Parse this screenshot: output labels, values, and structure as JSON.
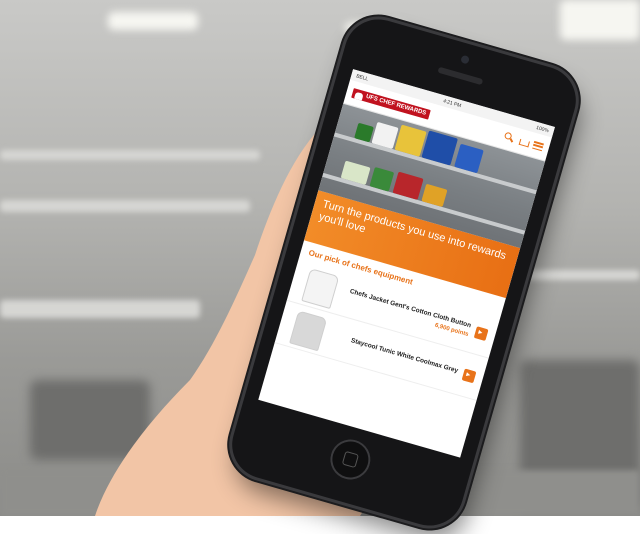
{
  "status_bar": {
    "carrier": "BELL",
    "time": "4:21 PM",
    "battery": "100%"
  },
  "app": {
    "logo_text": "UFS CHEF REWARDS"
  },
  "banner": {
    "headline": "Turn the products you use into rewards you'll love"
  },
  "section": {
    "title": "Our pick of chefs equipment"
  },
  "products": [
    {
      "name": "Chefs Jacket Gent's Cotton Cloth Button",
      "points": "6,900 points"
    },
    {
      "name": "Staycool Tunic White Coolmax Grey",
      "points": ""
    }
  ],
  "colors": {
    "accent": "#e8731a",
    "brand_red": "#c1121f"
  }
}
